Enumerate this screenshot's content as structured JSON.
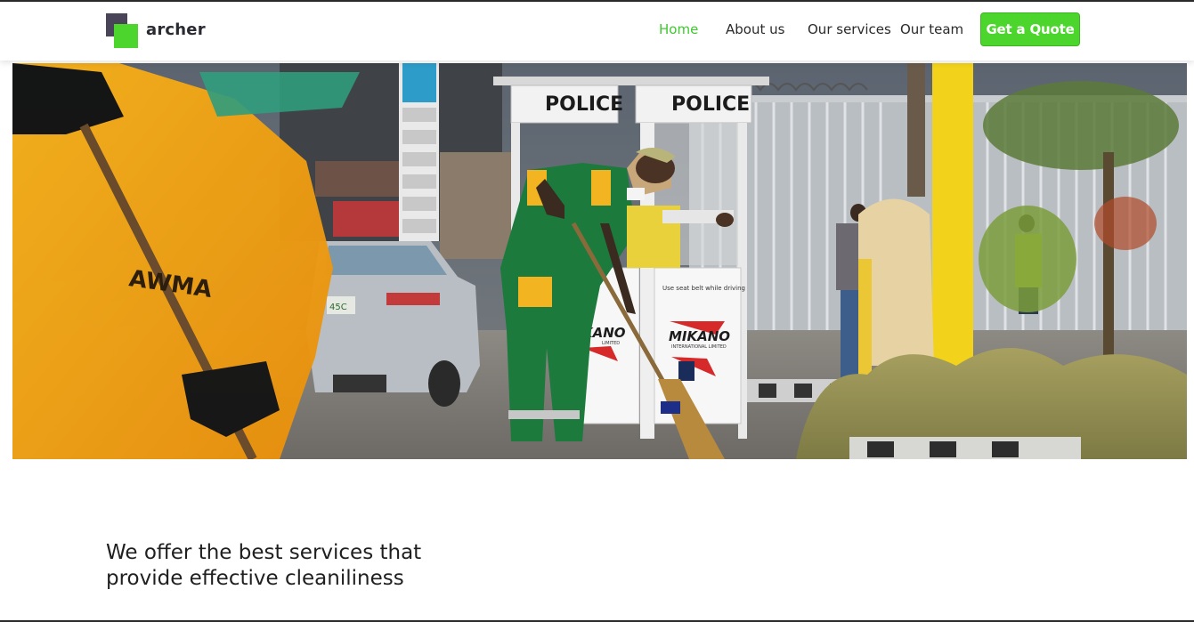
{
  "brand": {
    "name": "archer",
    "accent_color": "#4cd62d",
    "dark_color": "#4a4458"
  },
  "nav": {
    "items": [
      {
        "label": "Home",
        "active": true
      },
      {
        "label": "About us",
        "active": false
      },
      {
        "label": "Our services",
        "active": false
      },
      {
        "label": "Our team",
        "active": false
      }
    ],
    "cta_label": "Get a Quote"
  },
  "hero": {
    "booth_sign_left": "POLICE",
    "booth_sign_right": "POLICE",
    "panel_notice": "Use seat belt while driving",
    "panel_brand": "MIKANO",
    "panel_brand_sub": "INTERNATIONAL LIMITED",
    "panel_brand_left": "KANO",
    "panel_brand_left_sub": "LIMITED",
    "vest_letters": "AWMA",
    "plate_text": "45C"
  },
  "main": {
    "tagline": "We offer the best services that provide effective cleaniliness"
  }
}
